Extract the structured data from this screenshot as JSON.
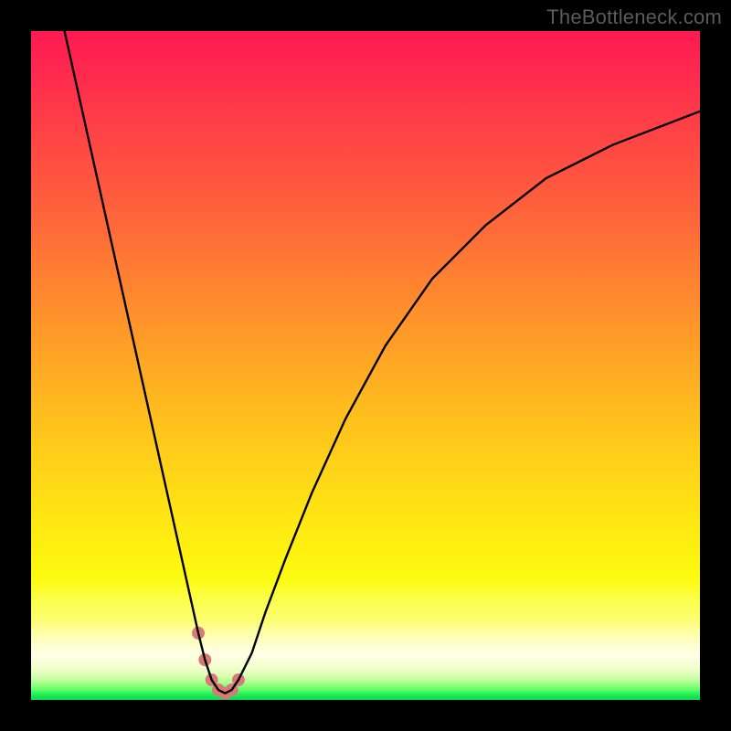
{
  "watermark": "TheBottleneck.com",
  "chart_data": {
    "type": "line",
    "title": "",
    "xlabel": "",
    "ylabel": "",
    "xlim": [
      0,
      100
    ],
    "ylim": [
      0,
      100
    ],
    "grid": false,
    "legend": false,
    "series": [
      {
        "name": "bottleneck-curve",
        "x": [
          5,
          7,
          9,
          11,
          13,
          15,
          17,
          19,
          21,
          23,
          25,
          26,
          27,
          28,
          29,
          30,
          31,
          33,
          35,
          38,
          42,
          47,
          53,
          60,
          68,
          77,
          87,
          100
        ],
        "values": [
          100,
          91,
          82,
          73,
          64,
          55,
          46,
          37,
          28,
          19,
          10,
          6,
          3,
          1.5,
          1,
          1.5,
          3,
          7,
          13,
          21,
          31,
          42,
          53,
          63,
          71,
          78,
          83,
          88
        ]
      },
      {
        "name": "marker-dots",
        "x": [
          25,
          26,
          27,
          28,
          29,
          30,
          31
        ],
        "values": [
          10,
          6,
          3,
          1.5,
          1,
          1.5,
          3
        ]
      }
    ],
    "colors": {
      "curve": "#000000",
      "dots": "#d97a78",
      "gradient_top": "#ff1a52",
      "gradient_mid": "#ffd019",
      "gradient_bottom": "#19eb55"
    }
  }
}
